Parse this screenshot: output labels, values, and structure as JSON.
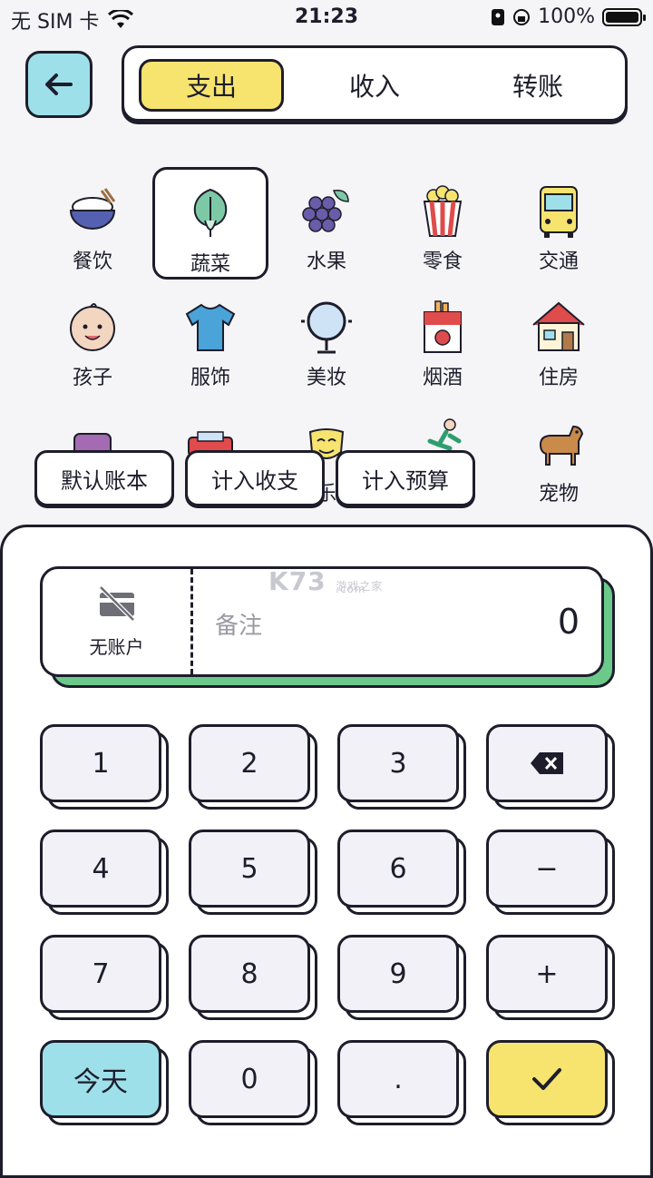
{
  "status_bar": {
    "carrier": "无 SIM 卡",
    "time": "21:23",
    "battery": "100%"
  },
  "tabs": [
    {
      "label": "支出",
      "active": true
    },
    {
      "label": "收入",
      "active": false
    },
    {
      "label": "转账",
      "active": false
    }
  ],
  "categories": [
    {
      "label": "餐饮",
      "icon": "rice-bowl-icon"
    },
    {
      "label": "蔬菜",
      "icon": "vegetable-icon",
      "selected": true
    },
    {
      "label": "水果",
      "icon": "grapes-icon"
    },
    {
      "label": "零食",
      "icon": "popcorn-icon"
    },
    {
      "label": "交通",
      "icon": "bus-icon"
    },
    {
      "label": "孩子",
      "icon": "baby-icon"
    },
    {
      "label": "服饰",
      "icon": "shirt-icon"
    },
    {
      "label": "美妆",
      "icon": "mirror-icon"
    },
    {
      "label": "烟酒",
      "icon": "cigarette-icon"
    },
    {
      "label": "住房",
      "icon": "house-icon"
    },
    {
      "label": "",
      "icon": "sofa-icon"
    },
    {
      "label": "",
      "icon": "car-icon"
    },
    {
      "label": "乐",
      "icon": "mask-icon"
    },
    {
      "label": "",
      "icon": "runner-icon"
    },
    {
      "label": "宠物",
      "icon": "dog-icon"
    }
  ],
  "chips": {
    "ledger": "默认账本",
    "income_expense": "计入收支",
    "budget": "计入预算"
  },
  "entry": {
    "account": "无账户",
    "note_placeholder": "备注",
    "amount": "0"
  },
  "watermark": {
    "brand": "K73",
    "sub": "游戏之家",
    "domain": ".com"
  },
  "keypad": [
    "1",
    "2",
    "3",
    "⌫",
    "4",
    "5",
    "6",
    "−",
    "7",
    "8",
    "9",
    "+",
    "今天",
    "0",
    ".",
    "✓"
  ],
  "colors": {
    "accent_yellow": "#f6e46f",
    "accent_blue": "#9ee0ea",
    "green": "#6bc98a"
  }
}
